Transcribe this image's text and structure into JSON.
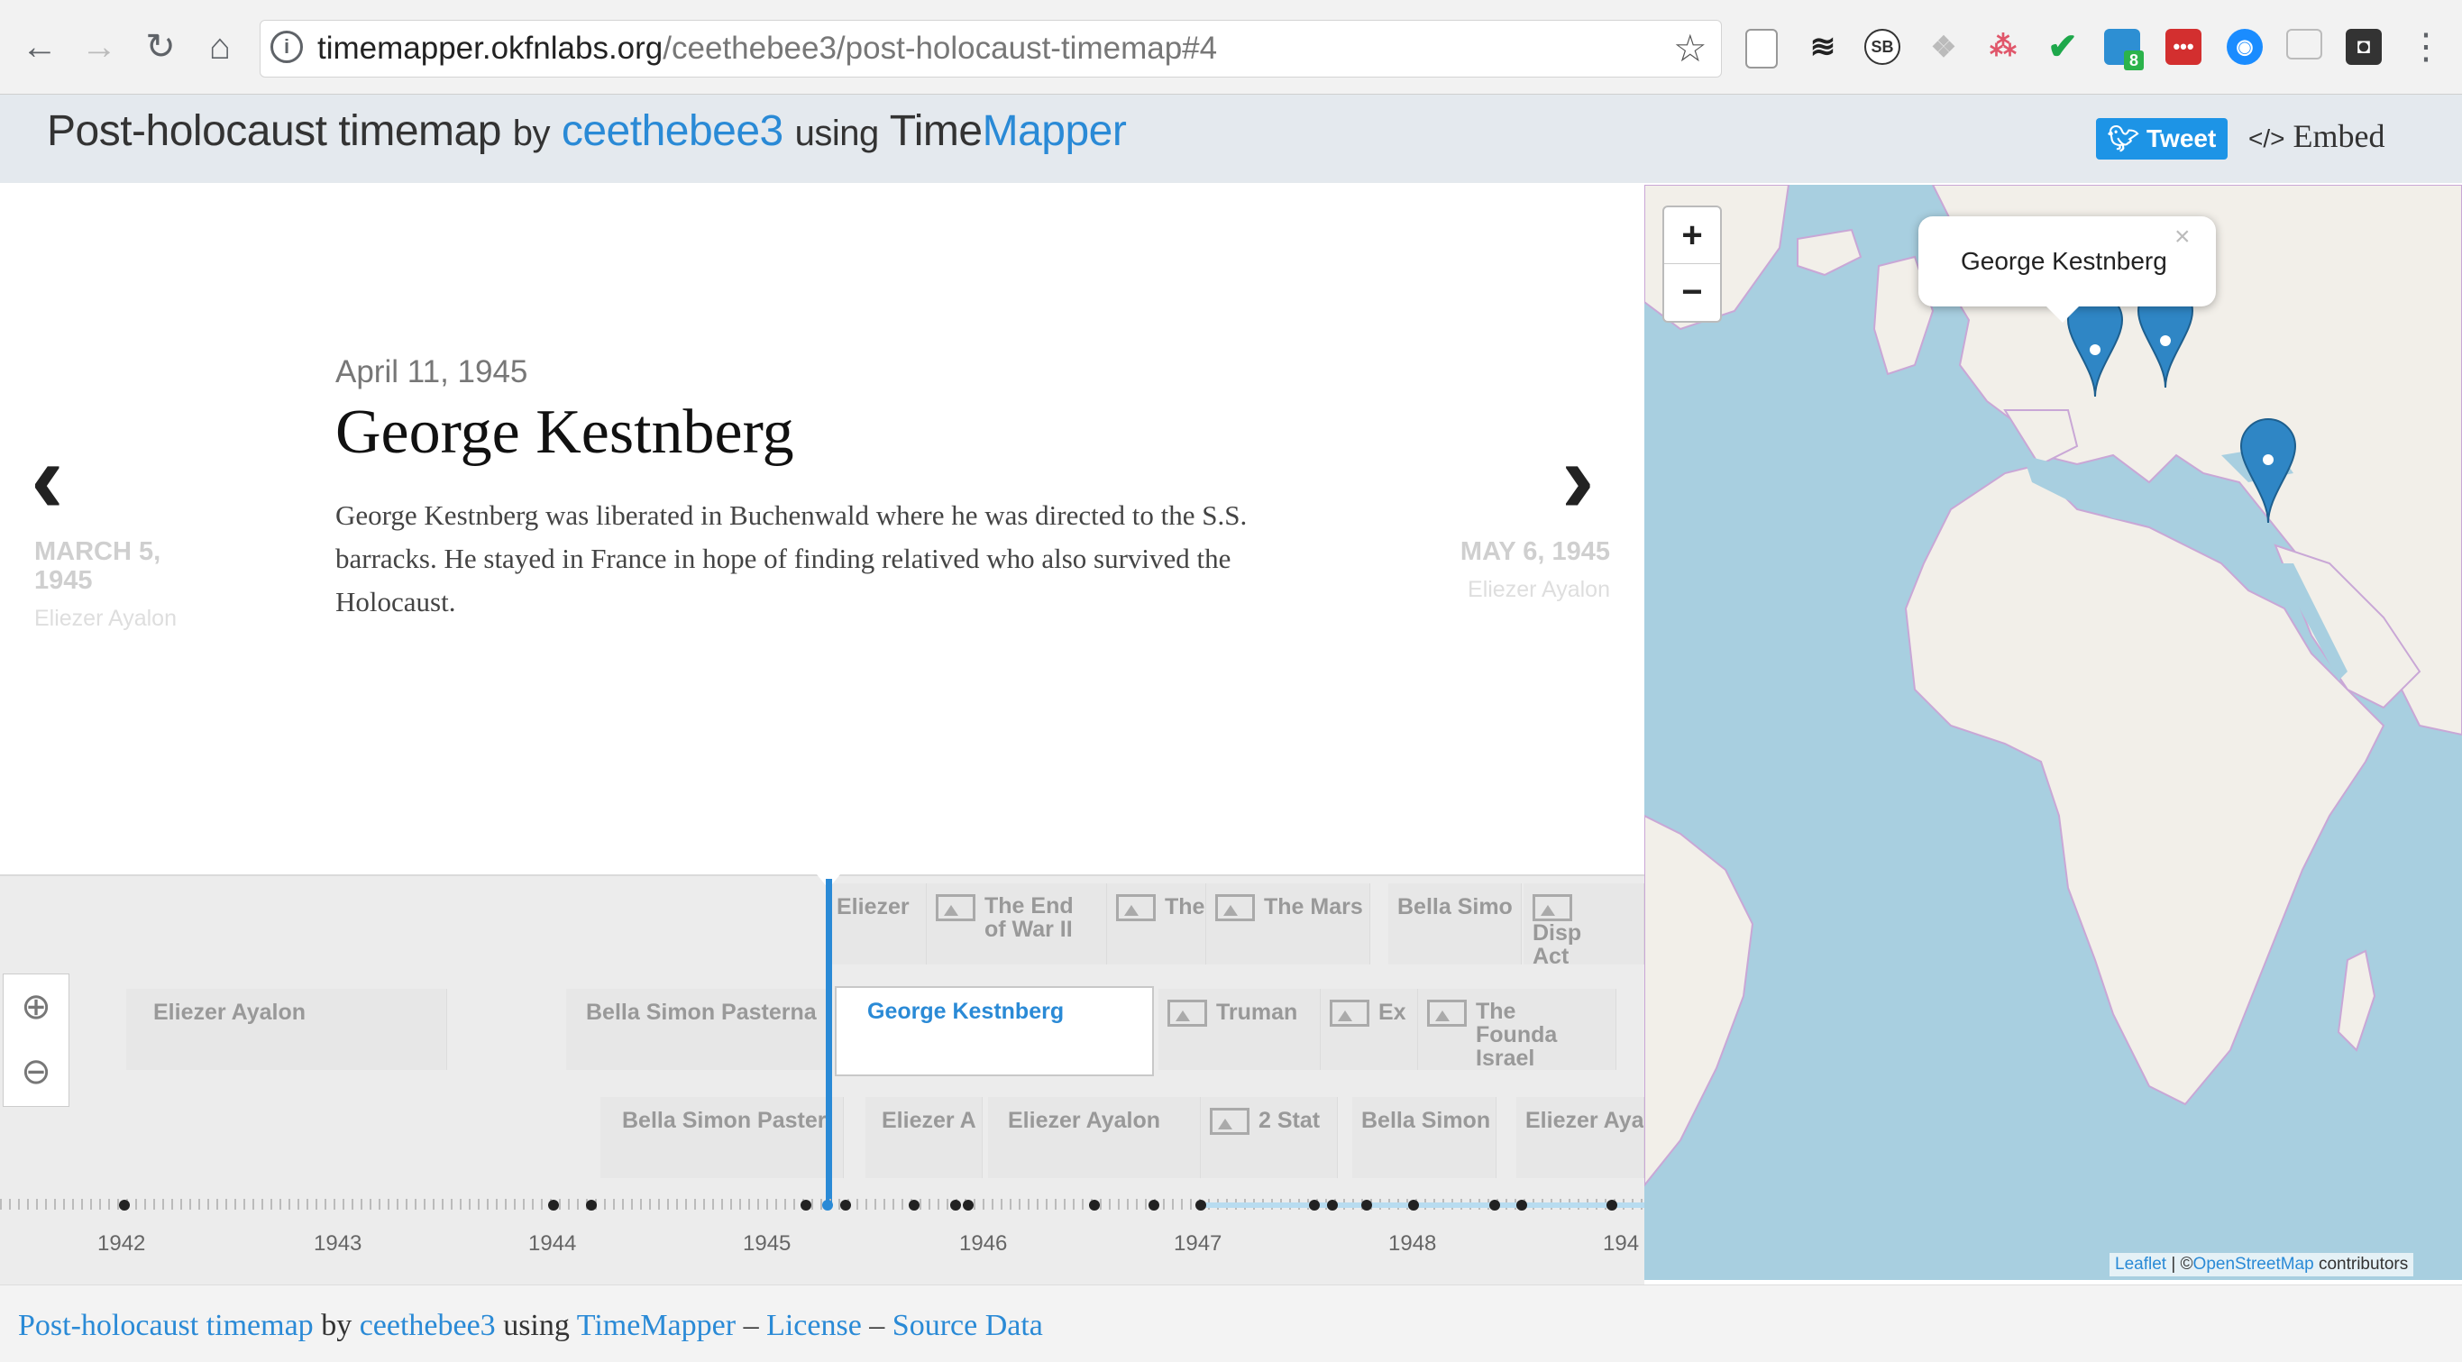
{
  "browser": {
    "url_host": "timemapper.okfnlabs.org",
    "url_path": "/ceethebee3/post-holocaust-timemap#4",
    "ext_sb": "SB",
    "ext_badge": "8"
  },
  "header": {
    "title": "Post-holocaust timemap",
    "by": "by",
    "user": "ceethebee3",
    "using": "using",
    "brand_time": "Time",
    "brand_mapper": "Mapper",
    "tweet_label": "Tweet",
    "embed_label": "Embed"
  },
  "story": {
    "prev": {
      "date": "MARCH 5, 1945",
      "author": "Eliezer Ayalon"
    },
    "next": {
      "date": "MAY 6, 1945",
      "author": "Eliezer Ayalon"
    },
    "event": {
      "date": "April 11, 1945",
      "title": "George Kestnberg",
      "text": "George Kestnberg was liberated in Buchenwald where he was directed to the S.S. barracks. He stayed in France in hope of finding relatived who also survived the Holocaust."
    }
  },
  "timeline": {
    "row1": [
      "Eliezer",
      "The End of War II",
      "The",
      "The Mars",
      "Bella Simo",
      "Disp Act"
    ],
    "row2": [
      "Eliezer Ayalon",
      "Bella Simon Pasterna",
      "George Kestnberg",
      "Truman",
      "Ex",
      "The Founda Israel"
    ],
    "row3": [
      "Bella Simon Paster",
      "Eliezer A",
      "Eliezer Ayalon",
      "2 Stat",
      "Bella Simon",
      "Eliezer Aya"
    ],
    "years": [
      "1942",
      "1943",
      "1944",
      "1945",
      "1946",
      "1947",
      "1948",
      "194"
    ]
  },
  "map": {
    "popup_title": "George Kestnberg",
    "zoom_in": "+",
    "zoom_out": "−",
    "attr_leaflet": "Leaflet",
    "attr_sep": "| ©",
    "attr_osm": "OpenStreetMap",
    "attr_contrib": "contributors"
  },
  "footer": {
    "title": "Post-holocaust timemap",
    "by": "by",
    "user": "ceethebee3",
    "using": "using",
    "app": "TimeMapper",
    "dash": "–",
    "license": "License",
    "source": "Source Data"
  },
  "colors": {
    "accent": "#2a8ad6",
    "tweet": "#1d94e6",
    "map_water": "#a8cfe0",
    "map_land": "#f2efe9"
  }
}
